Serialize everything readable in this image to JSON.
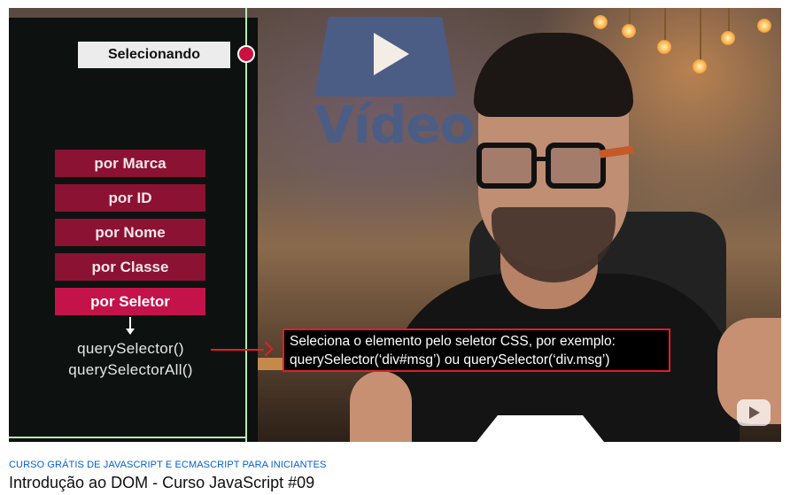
{
  "overlay": {
    "heading": "Selecionando",
    "menu_items": [
      {
        "label": "por Marca",
        "active": false
      },
      {
        "label": "por ID",
        "active": false
      },
      {
        "label": "por Nome",
        "active": false
      },
      {
        "label": "por Classe",
        "active": false
      },
      {
        "label": "por Seletor",
        "active": true
      }
    ],
    "methods": [
      "querySelector()",
      "querySelectorAll()"
    ],
    "caption_line1": "Seleciona o elemento pelo seletor CSS, por exemplo:",
    "caption_line2": "querySelector(‘div#msg’) ou querySelector(‘div.msg’)"
  },
  "background": {
    "logo_text": "Vídeo"
  },
  "info": {
    "playlist_label": "CURSO GRÁTIS DE JAVASCRIPT E ECMASCRIPT PARA INICIANTES",
    "video_title": "Introdução ao DOM - Curso JavaScript #09"
  },
  "icons": {
    "play_logo": "play-icon",
    "watermark": "youtube-watermark-icon"
  },
  "colors": {
    "menu_item": "#8c1233",
    "menu_item_active": "#c4134a",
    "accent_red": "#e31c2b",
    "panel_bg": "#0d1210",
    "link_blue": "#065fd4"
  }
}
